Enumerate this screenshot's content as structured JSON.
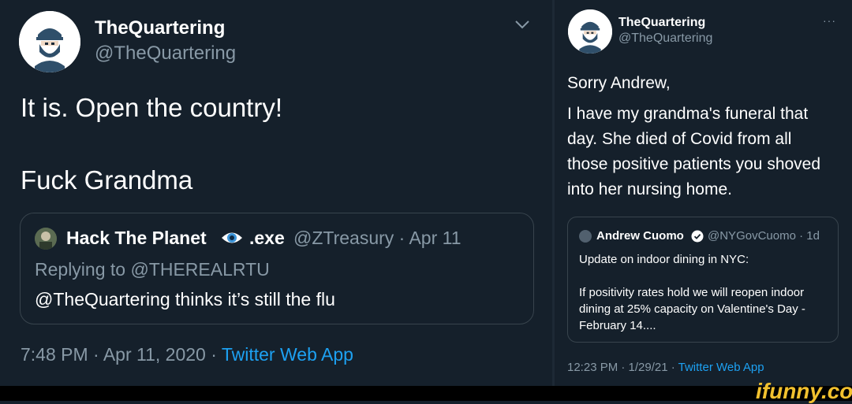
{
  "left_tweet": {
    "name": "TheQuartering",
    "handle": "@TheQuartering",
    "text_line1": "It is.  Open the country!",
    "text_line2": "Fuck Grandma",
    "quote": {
      "name": "Hack The Planet",
      "exe": ".exe",
      "meta": "@ZTreasury · Apr 11",
      "replying": "Replying to @THEREALRTU",
      "body": "@TheQuartering thinks it’s still the flu"
    },
    "time": "7:48 PM · Apr 11, 2020 · ",
    "source": "Twitter Web App"
  },
  "right_tweet": {
    "name": "TheQuartering",
    "handle": "@TheQuartering",
    "more": "···",
    "text_line1": "Sorry Andrew,",
    "text_line2": "I have my grandma's funeral that day.  She died of Covid from all those positive patients you shoved into her nursing home.",
    "quote": {
      "name": "Andrew Cuomo",
      "meta": "@NYGovCuomo · 1d",
      "line1": "Update on indoor dining in NYC:",
      "line2": "If positivity rates hold we will reopen indoor dining at 25% capacity on Valentine's Day - February 14...."
    },
    "time": "12:23 PM · 1/29/21 · ",
    "source": "Twitter Web App"
  },
  "watermark": "ifunny.co",
  "colors": {
    "background": "#15202b",
    "secondary_text": "#8899a6",
    "link": "#1da1f2",
    "border": "#38444d",
    "watermark": "#f2c12e"
  },
  "icons": [
    "avatar",
    "chevron-down-icon",
    "eye-icon",
    "verified-icon",
    "more-icon"
  ]
}
